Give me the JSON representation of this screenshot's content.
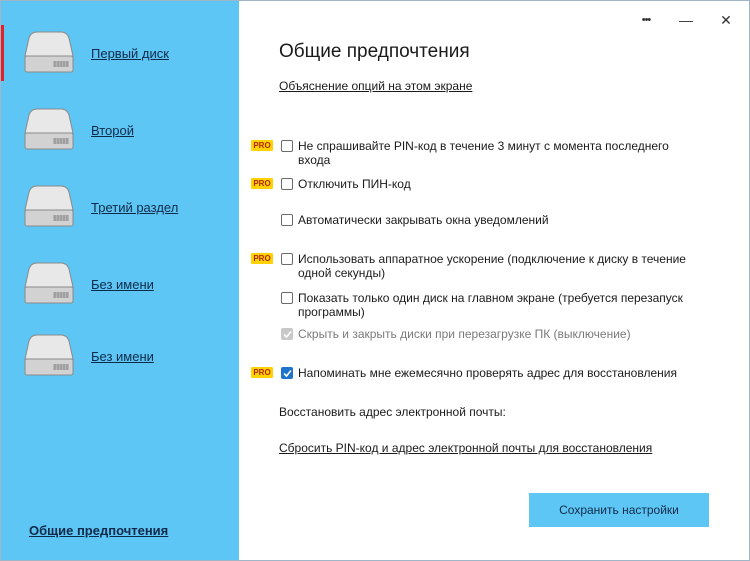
{
  "sidebar": {
    "disks": [
      {
        "label": "Первый диск",
        "selected": true
      },
      {
        "label": "Второй",
        "selected": false
      },
      {
        "label": "Третий раздел",
        "selected": false
      },
      {
        "label": "Без имени",
        "selected": false
      },
      {
        "label": "Без имени",
        "selected": false
      }
    ],
    "footer_link": "Общие предпочтения"
  },
  "titlebar": {
    "more": "•••",
    "minimize": "—",
    "close": "✕"
  },
  "main": {
    "title": "Общие предпочтения",
    "help_link": "Объяснение опций на этом экране",
    "pro_label": "PRO",
    "options": [
      {
        "text": "Не спрашивайте PIN-код в течение 3 минут с момента последнего входа",
        "pro": true,
        "checked": false,
        "disabled": false
      },
      {
        "text": "Отключить ПИН-код",
        "pro": true,
        "checked": false,
        "disabled": false
      },
      {
        "text": "Автоматически закрывать окна уведомлений",
        "pro": false,
        "checked": false,
        "disabled": false
      },
      {
        "text": "Использовать аппаратное ускорение (подключение к диску в течение одной секунды)",
        "pro": true,
        "checked": false,
        "disabled": false
      },
      {
        "text": "Показать только один диск на главном экране (требуется перезапуск программы)",
        "pro": false,
        "checked": false,
        "disabled": false
      },
      {
        "text": "Скрыть и закрыть диски при перезагрузке ПК (выключение)",
        "pro": false,
        "checked": true,
        "disabled": true
      },
      {
        "text": "Напоминать мне ежемесячно проверять адрес для восстановления",
        "pro": true,
        "checked": true,
        "disabled": false
      }
    ],
    "recovery_email_label": "Восстановить адрес электронной почты:",
    "reset_link": "Сбросить PIN-код и адрес электронной почты для восстановления",
    "save_button": "Сохранить настройки"
  },
  "colors": {
    "sidebar_bg": "#5ec6f5",
    "accent_selected": "#e3212b",
    "pro_badge": "#ffd200",
    "checkbox_checked": "#1e74cc"
  }
}
